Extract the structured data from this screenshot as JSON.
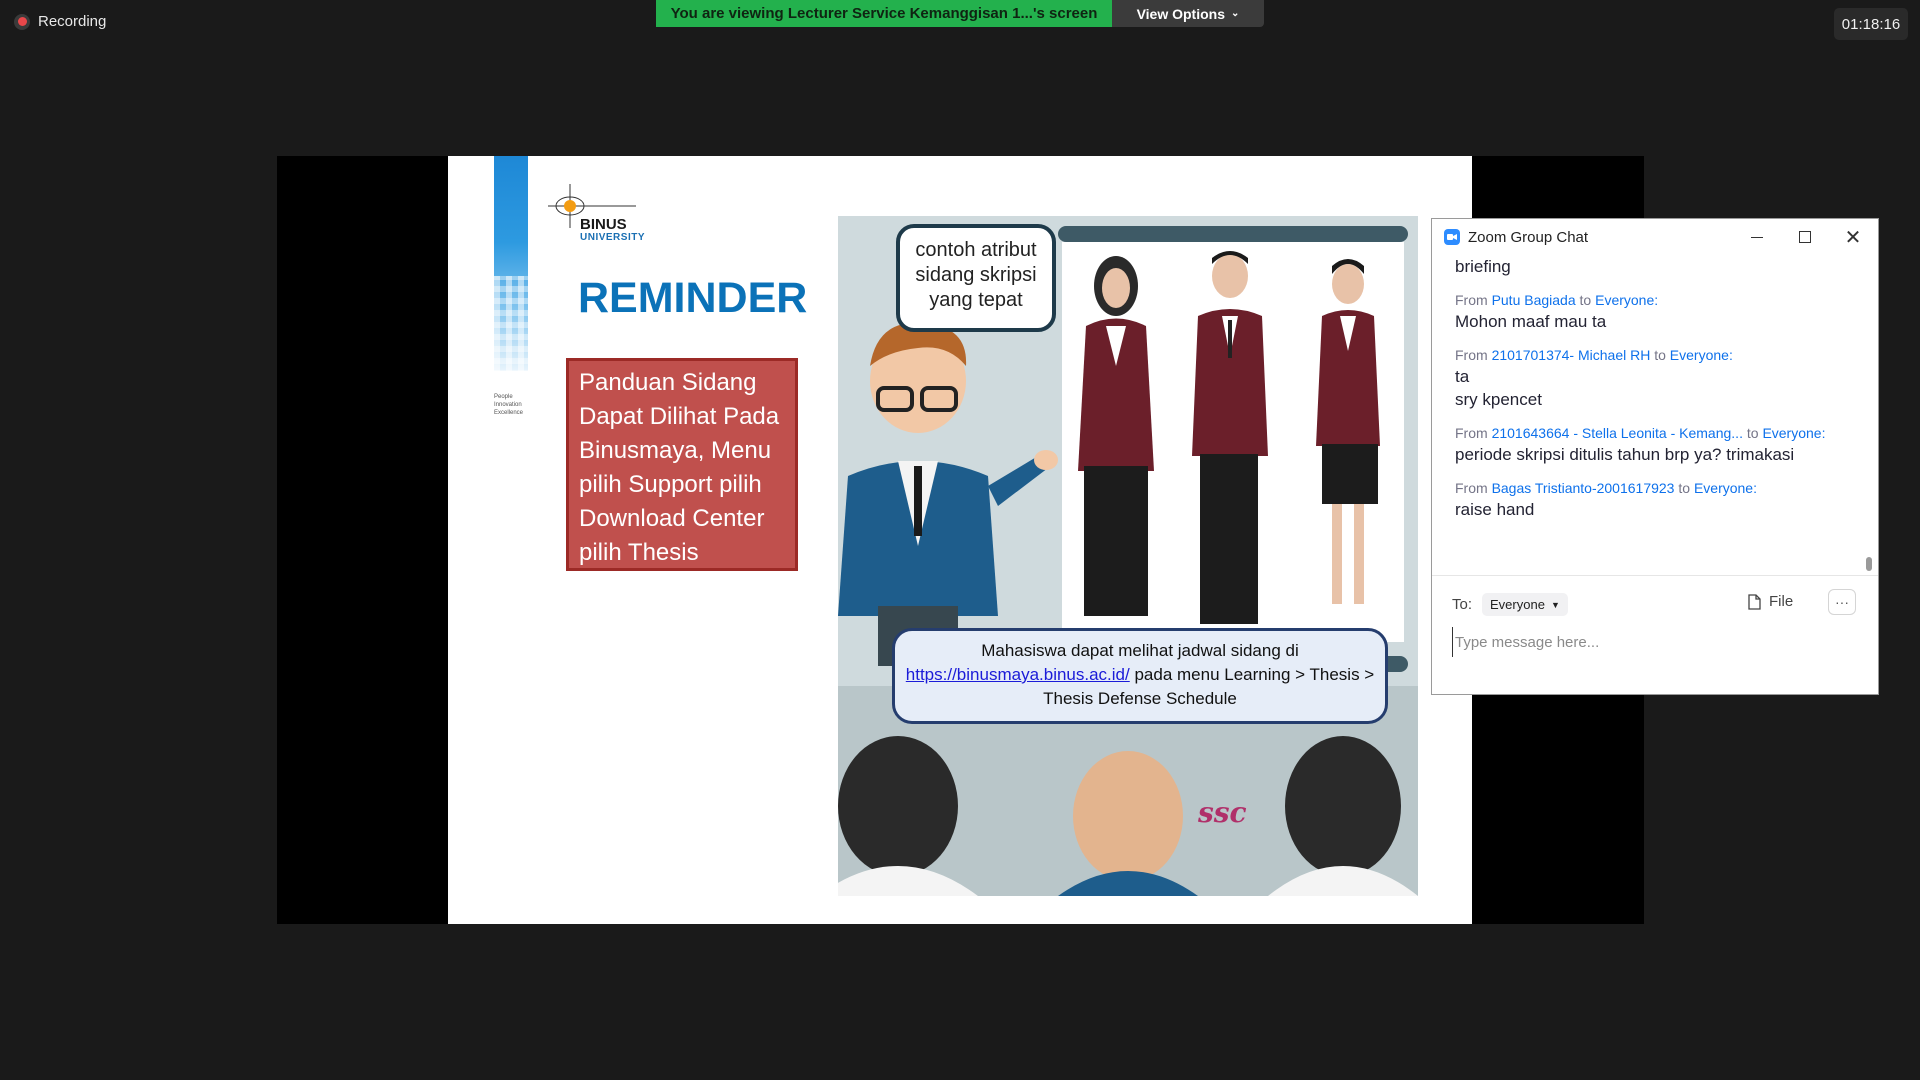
{
  "topbar": {
    "recording_label": "Recording",
    "viewing_text": "You are viewing Lecturer Service Kemanggisan 1...'s screen",
    "view_options_label": "View Options",
    "timer": "01:18:16"
  },
  "slide": {
    "logo_word": "BINUS",
    "logo_sub": "UNIVERSITY",
    "tagline": [
      "People",
      "Innovation",
      "Excellence"
    ],
    "title": "REMINDER",
    "red_box_text": "Panduan Sidang Dapat Dilihat Pada Binusmaya, Menu pilih Support pilih Download Center pilih Thesis",
    "bubble_top": "contoh atribut sidang skripsi yang tepat",
    "bubble_bottom_pre": "Mahasiswa dapat melihat jadwal sidang di",
    "bubble_bottom_link": "https://binusmaya.binus.ac.id/",
    "bubble_bottom_post": " pada  menu Learning > Thesis > Thesis Defense Schedule",
    "watermark": "ssc",
    "colors": {
      "title_blue": "#0b72b8",
      "red_box": "#c0504d",
      "blazer": "#6b1f2a"
    }
  },
  "chat": {
    "title": "Zoom Group Chat",
    "messages": [
      {
        "from": "",
        "to": "",
        "lines": [
          "briefing"
        ]
      },
      {
        "from": "Putu Bagiada",
        "to": "Everyone:",
        "lines": [
          "Mohon maaf mau ta"
        ]
      },
      {
        "from": "2101701374- Michael RH",
        "to": "Everyone:",
        "lines": [
          "ta",
          "sry kpencet"
        ]
      },
      {
        "from": "2101643664 - Stella Leonita - Kemang...",
        "to": "Everyone:",
        "lines": [
          "periode skripsi ditulis tahun brp ya? trimakasi"
        ]
      },
      {
        "from": "Bagas Tristianto-2001617923",
        "to": "Everyone:",
        "lines": [
          "raise hand"
        ]
      }
    ],
    "from_word": "From",
    "to_word": "to",
    "to_label": "To:",
    "recipient": "Everyone",
    "file_label": "File",
    "more_label": "···",
    "input_placeholder": "Type message here..."
  }
}
